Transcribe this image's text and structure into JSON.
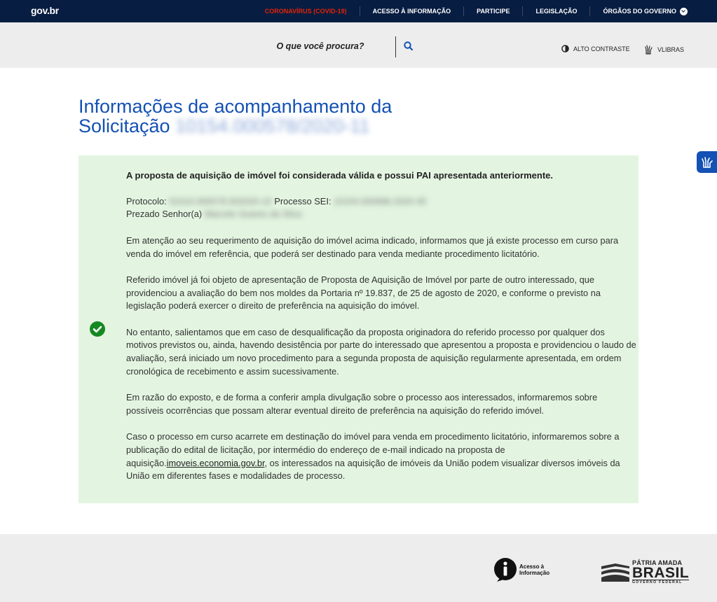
{
  "header": {
    "logo": "gov.br",
    "nav": [
      "CORONAVÍRUS (COVID-19)",
      "ACESSO À INFORMAÇÃO",
      "PARTICIPE",
      "LEGISLAÇÃO",
      "ÓRGÃOS DO GOVERNO"
    ],
    "nav_colors": {
      "highlight": "#e52207",
      "bar": "#071d41"
    }
  },
  "search": {
    "placeholder": "O que você procura?",
    "icon": "search-icon"
  },
  "tools": {
    "contrast_label": "ALTO CONTRASTE",
    "vlibras_label": "VLIBRAS"
  },
  "page": {
    "title_line1": "Informações de acompanhamento da",
    "title_line2": "Solicitação",
    "title_redacted": "10154.000578/2020-11",
    "accent_color": "#1351b4"
  },
  "notice": {
    "status_icon": "check-circle-icon",
    "status_color": "#168821",
    "background": "#e3f5e1",
    "headline": "A proposta de aquisição de imóvel foi considerada válida e possui PAI apresentada anteriormente.",
    "protocol_label": "Protocolo:",
    "protocol_value": "01010.000578.002020-10",
    "sei_label": "Processo SEI:",
    "sei_value": "10154.000686.2020-45",
    "greeting_label": "Prezado Senhor(a)",
    "greeting_name": "Marcelo Soares da Silva",
    "p1": "Em atenção ao seu requerimento de aquisição do imóvel acima indicado, informamos que já existe processo em curso para venda do imóvel em referência, que poderá ser destinado para venda mediante procedimento licitatório.",
    "p2": "Referido imóvel já foi objeto de apresentação de Proposta de Aquisição de Imóvel por parte de outro interessado, que providenciou a avaliação do bem nos moldes da Portaria nº 19.837, de 25 de agosto de 2020, e conforme o previsto na legislação poderá exercer o direito de preferência na aquisição do imóvel.",
    "p3": "No entanto, salientamos que em caso de desqualificação da proposta originadora do referido processo por qualquer dos motivos previstos ou, ainda, havendo desistência por parte do interessado que apresentou a proposta e providenciou o laudo de avaliação, será iniciado um novo procedimento para a segunda proposta de aquisição regularmente apresentada, em ordem cronológica de recebimento e assim sucessivamente.",
    "p4": "Em razão do exposto, e de forma a conferir ampla divulgação sobre o processo aos interessados, informaremos sobre possíveis ocorrências que possam alterar eventual direito de preferência na aquisição do referido imóvel.",
    "p5_start": "Caso o processo em curso acarrete em destinação do imóvel para venda em procedimento licitatório, informaremos sobre a publicação do edital de licitação, por intermédio do endereço de e-mail indicado na proposta de aquisição.",
    "p5_link": "imoveis.economia.gov.br",
    "p5_end": ", os interessados na aquisição de imóveis da União podem visualizar diversos imóveis da União em diferentes fases e modalidades de processo."
  },
  "footer": {
    "acesso": "Acesso à Informação",
    "patria_l1": "PÁTRIA AMADA",
    "patria_l2": "BRASIL",
    "patria_l3": "GOVERNO FEDERAL"
  }
}
